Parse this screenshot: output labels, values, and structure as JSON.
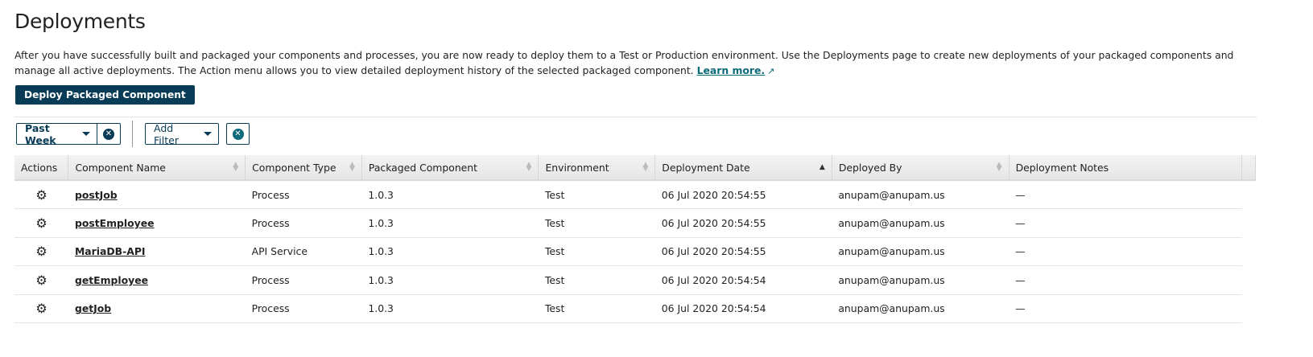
{
  "page": {
    "title": "Deployments",
    "description": "After you have successfully built and packaged your components and processes, you are now ready to deploy them to a Test or Production environment. Use the Deployments page to create new deployments of your packaged components and manage all active deployments. The Action menu allows you to view detailed deployment history of the selected packaged component.",
    "learn_more": "Learn more.",
    "deploy_button": "Deploy Packaged Component"
  },
  "filters": {
    "time_range": "Past Week",
    "add_filter": "Add Filter"
  },
  "table": {
    "columns": [
      "Actions",
      "Component Name",
      "Component Type",
      "Packaged Component",
      "Environment",
      "Deployment Date",
      "Deployed By",
      "Deployment Notes"
    ],
    "sorted_column": "Deployment Date",
    "sort_direction": "ascending",
    "rows": [
      {
        "name": "postJob",
        "type": "Process",
        "version": "1.0.3",
        "env": "Test",
        "date": "06 Jul 2020 20:54:55",
        "by": "anupam@anupam.us",
        "notes": "—"
      },
      {
        "name": "postEmployee",
        "type": "Process",
        "version": "1.0.3",
        "env": "Test",
        "date": "06 Jul 2020 20:54:55",
        "by": "anupam@anupam.us",
        "notes": "—"
      },
      {
        "name": "MariaDB-API",
        "type": "API Service",
        "version": "1.0.3",
        "env": "Test",
        "date": "06 Jul 2020 20:54:55",
        "by": "anupam@anupam.us",
        "notes": "—"
      },
      {
        "name": "getEmployee",
        "type": "Process",
        "version": "1.0.3",
        "env": "Test",
        "date": "06 Jul 2020 20:54:54",
        "by": "anupam@anupam.us",
        "notes": "—"
      },
      {
        "name": "getJob",
        "type": "Process",
        "version": "1.0.3",
        "env": "Test",
        "date": "06 Jul 2020 20:54:54",
        "by": "anupam@anupam.us",
        "notes": "—"
      }
    ]
  }
}
